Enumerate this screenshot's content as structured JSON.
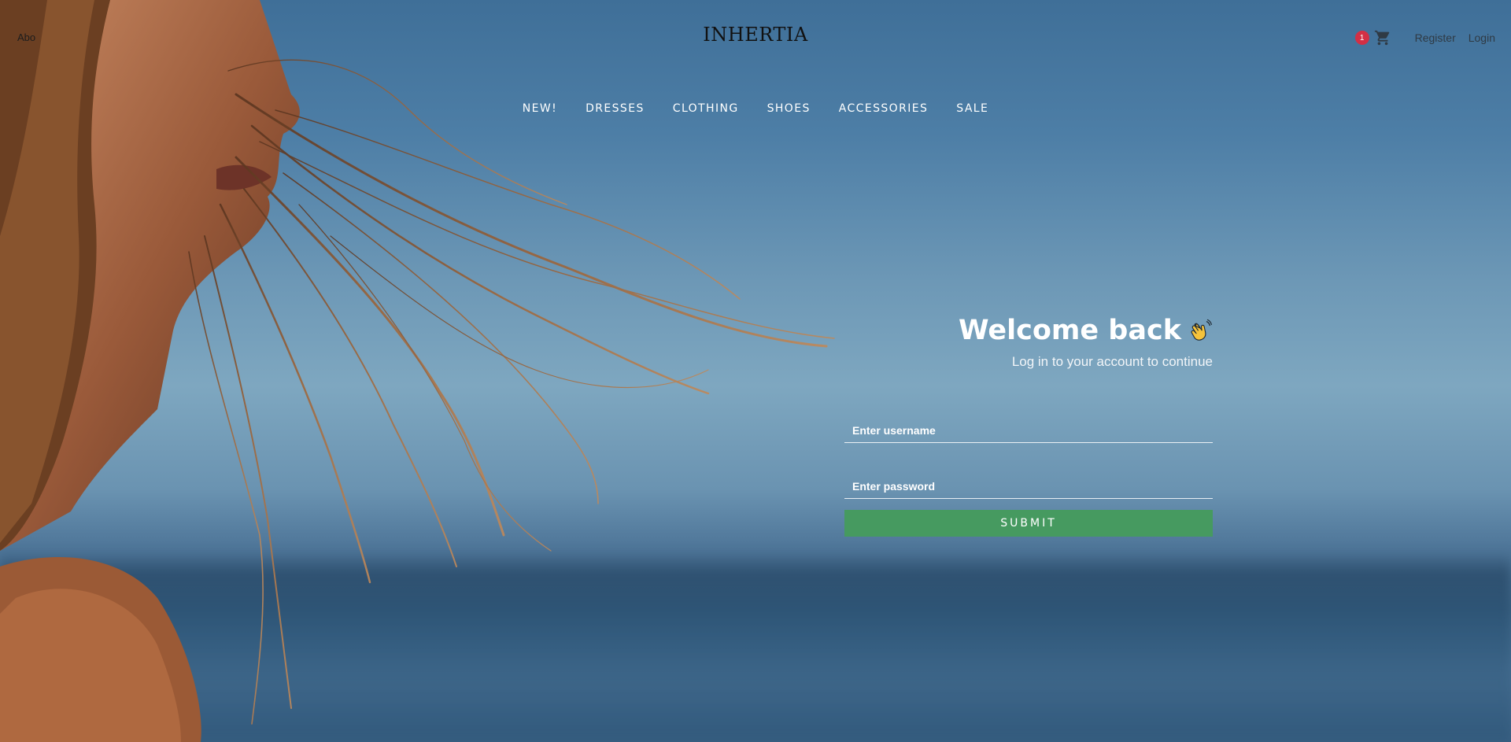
{
  "header": {
    "top_left_text": "Abo",
    "logo": "INHERTIA",
    "cart_count": "1",
    "register_label": "Register",
    "login_label": "Login"
  },
  "nav": {
    "items": [
      {
        "label": "NEW!"
      },
      {
        "label": "DRESSES"
      },
      {
        "label": "CLOTHING"
      },
      {
        "label": "SHOES"
      },
      {
        "label": "ACCESSORIES"
      },
      {
        "label": "SALE"
      }
    ]
  },
  "login": {
    "title": "Welcome back",
    "subtitle": "Log in to your account to continue",
    "username_placeholder": "Enter username",
    "password_placeholder": "Enter password",
    "submit_label": "SUBMIT"
  },
  "icons": {
    "cart": "cart-icon",
    "wave": "waving-hand-icon"
  },
  "colors": {
    "submit_button": "#469a60",
    "cart_badge": "#d32f45"
  }
}
